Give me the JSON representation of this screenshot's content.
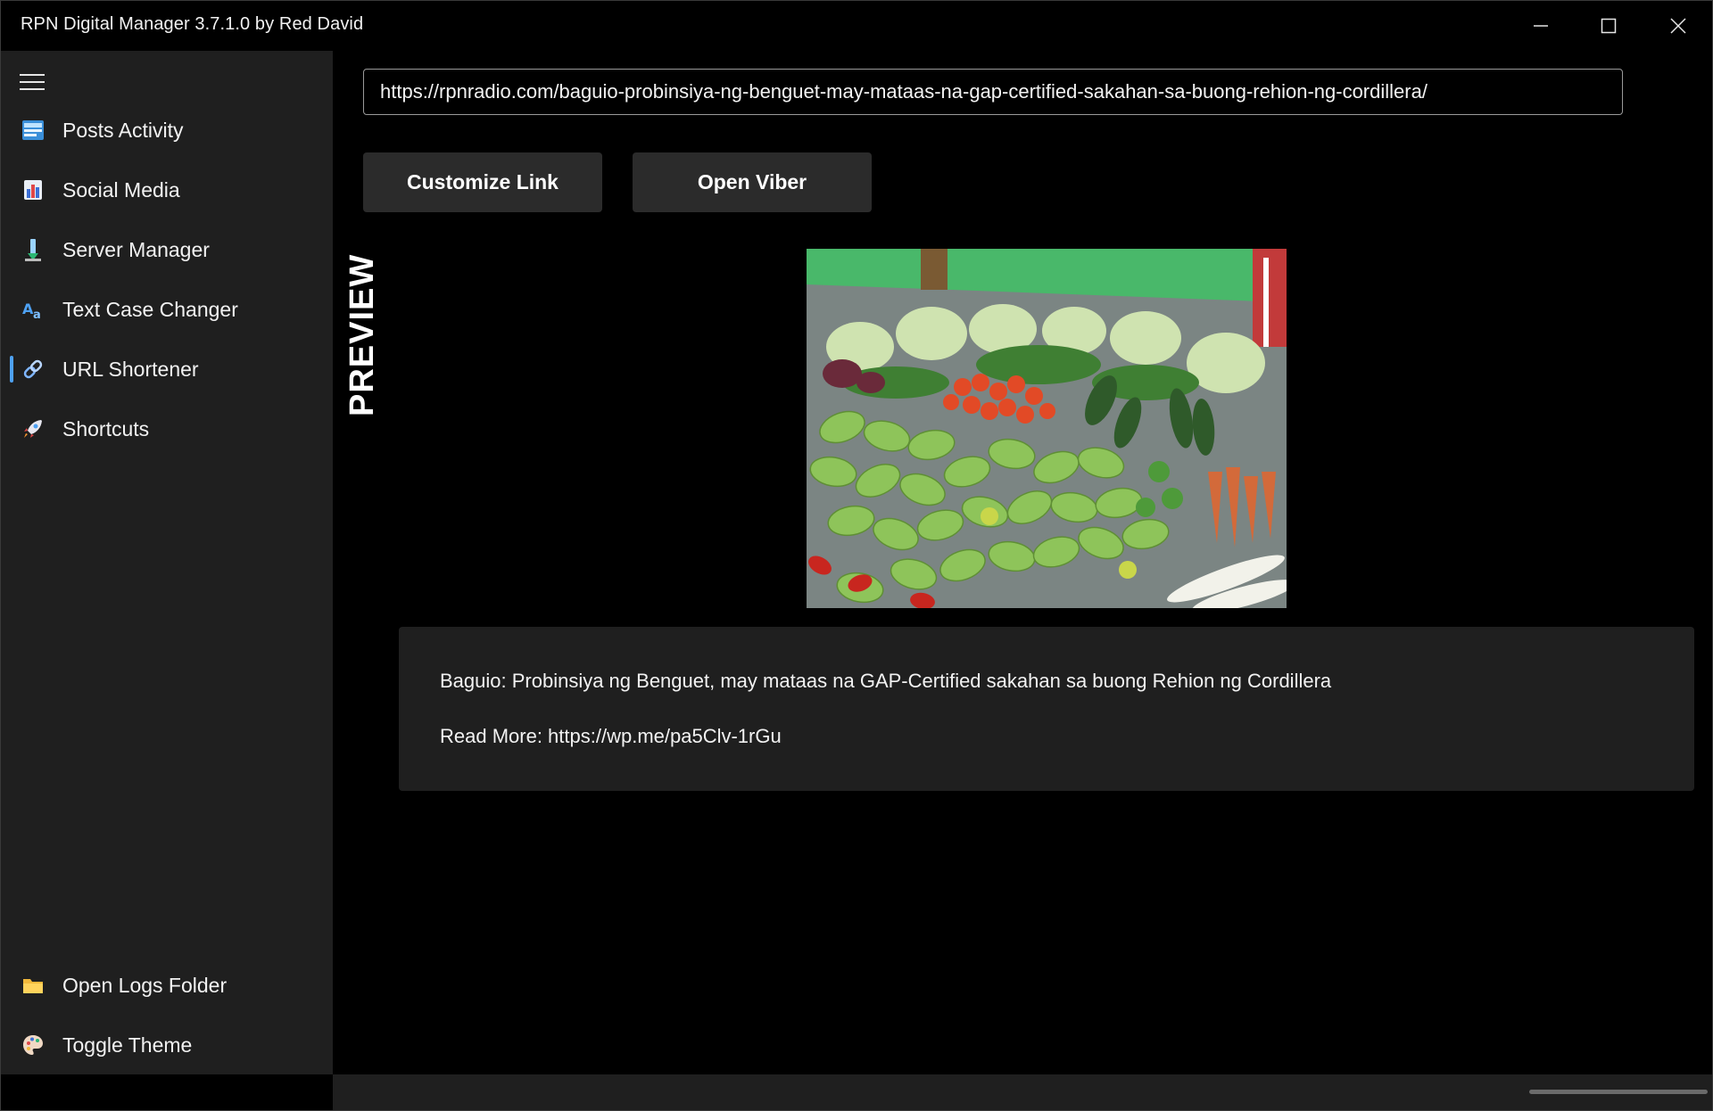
{
  "window": {
    "title": "RPN Digital Manager 3.7.1.0 by Red David"
  },
  "sidebar": {
    "items": [
      {
        "label": "Posts Activity",
        "icon": "posts-activity-icon"
      },
      {
        "label": "Social Media",
        "icon": "social-media-icon"
      },
      {
        "label": "Server Manager",
        "icon": "server-manager-icon"
      },
      {
        "label": "Text Case Changer",
        "icon": "text-case-icon"
      },
      {
        "label": "URL Shortener",
        "icon": "link-icon",
        "selected": true
      },
      {
        "label": "Shortcuts",
        "icon": "rocket-icon"
      }
    ],
    "footer_items": [
      {
        "label": "Open Logs Folder",
        "icon": "folder-icon"
      },
      {
        "label": "Toggle Theme",
        "icon": "palette-icon"
      }
    ]
  },
  "main": {
    "url_input": {
      "value": "https://rpnradio.com/baguio-probinsiya-ng-benguet-may-mataas-na-gap-certified-sakahan-sa-buong-rehion-ng-cordillera/"
    },
    "buttons": {
      "customize_label": "Customize Link",
      "viber_label": "Open Viber"
    },
    "preview": {
      "label": "PREVIEW",
      "title": "Baguio: Probinsiya ng Benguet, may mataas na GAP-Certified sakahan sa buong Rehion ng Cordillera",
      "read_more": "Read More: https://wp.me/pa5Clv-1rGu"
    }
  },
  "colors": {
    "accent": "#4ea1f3",
    "sidebar_bg": "#1f1f1f",
    "content_bg": "#000000",
    "button_bg": "#2b2b2b"
  }
}
